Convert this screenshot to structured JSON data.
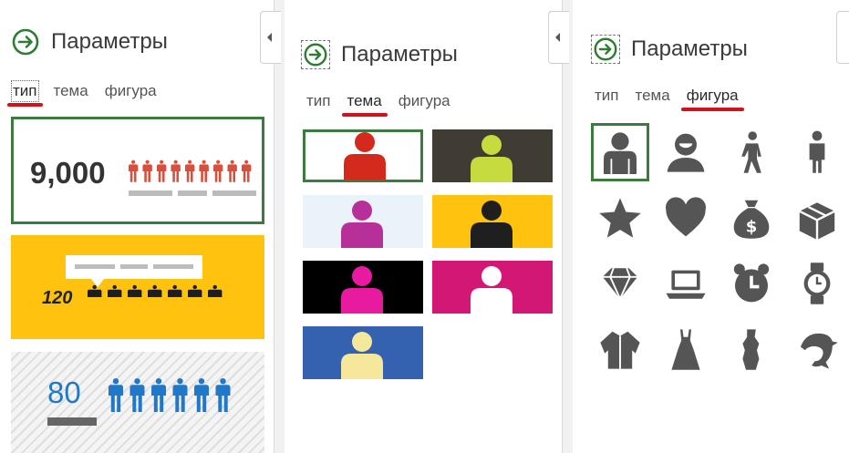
{
  "panels": [
    {
      "title": "Параметры",
      "tabs": [
        "тип",
        "тема",
        "фигура"
      ],
      "active_tab": "тип"
    },
    {
      "title": "Параметры",
      "tabs": [
        "тип",
        "тема",
        "фигура"
      ],
      "active_tab": "тема"
    },
    {
      "title": "Параметры",
      "tabs": [
        "тип",
        "тема",
        "фигура"
      ],
      "active_tab": "фигура"
    }
  ],
  "type_cards": [
    {
      "value": "9,000",
      "icon": "person-icon",
      "people": 9,
      "selected": true
    },
    {
      "value": "120",
      "icon": "person-icon",
      "people": 7,
      "selected": false
    },
    {
      "value": "80",
      "icon": "person-icon",
      "people": 6,
      "selected": false
    }
  ],
  "theme_swatches": [
    {
      "background": "#ffffff",
      "figure": "#d42a1e",
      "selected": true
    },
    {
      "background": "#403b33",
      "figure": "#c6db3d",
      "selected": false
    },
    {
      "background": "#eaf2fa",
      "figure": "#b7309a",
      "selected": false
    },
    {
      "background": "#ffc20e",
      "figure": "#1f1f1f",
      "selected": false
    },
    {
      "background": "#000000",
      "figure": "#e71aa0",
      "selected": false
    },
    {
      "background": "#d31774",
      "figure": "#ffffff",
      "selected": false
    },
    {
      "background": "#3461b0",
      "figure": "#f6e89a",
      "selected": false
    }
  ],
  "shapes": [
    "person-icon",
    "user-icon",
    "walking-man-icon",
    "man-icon",
    "star-icon",
    "heart-icon",
    "money-bag-icon",
    "box-icon",
    "diamond-icon",
    "laptop-icon",
    "alarm-clock-icon",
    "watch-icon",
    "jacket-icon",
    "dress-icon",
    "gown-icon",
    "dolphin-icon"
  ],
  "colors": {
    "accent_underline": "#d0121b",
    "selection_border": "#3d7a3d",
    "back_arrow": "#2e7d32",
    "shape_gray": "#555555",
    "infographic_blue": "#2178c9",
    "infographic_red": "#d94f3d"
  }
}
